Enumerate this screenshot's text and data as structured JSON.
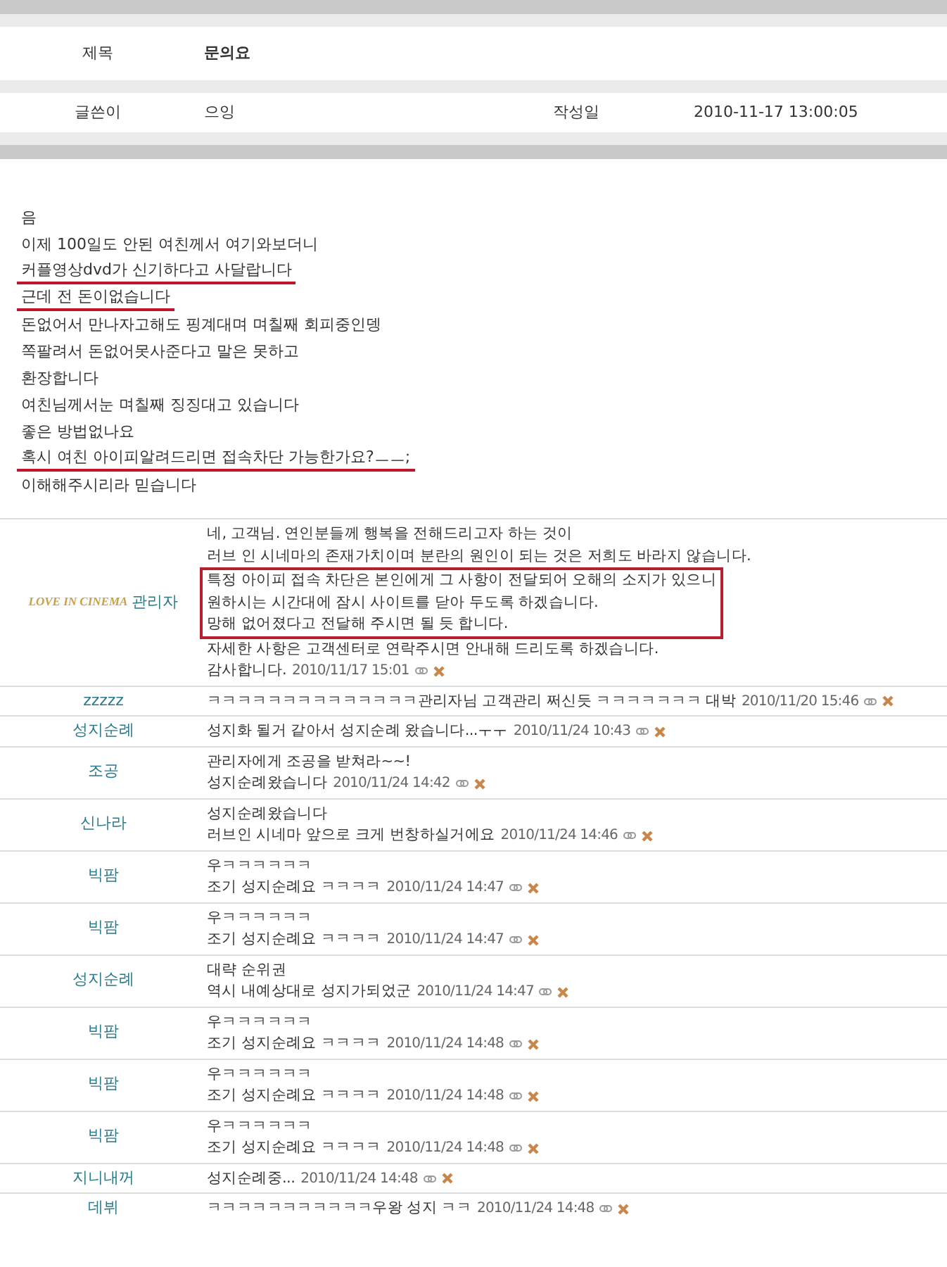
{
  "post": {
    "title_label": "제목",
    "title": "문의요",
    "author_label": "글쓴이",
    "author": "으잉",
    "date_label": "작성일",
    "date": "2010-11-17 13:00:05"
  },
  "body": [
    {
      "text": "음",
      "underlined": false
    },
    {
      "text": "이제 100일도 안된 여친께서 여기와보더니",
      "underlined": false
    },
    {
      "text": "커플영상dvd가 신기하다고 사달랍니다",
      "underlined": true
    },
    {
      "text": "근데 전 돈이없습니다",
      "underlined": true
    },
    {
      "text": "돈없어서 만나자고해도 핑계대며 며칠째 회피중인뎅",
      "underlined": false
    },
    {
      "text": "쪽팔려서 돈없어못사준다고 말은 못하고",
      "underlined": false
    },
    {
      "text": "환장합니다",
      "underlined": false
    },
    {
      "text": "여친님께서눈 며칠째 징징대고 있습니다",
      "underlined": false
    },
    {
      "text": "좋은 방법없나요",
      "underlined": false
    },
    {
      "text": "혹시 여친 아이피알려드리면 접속차단 가능한가요?ㅡㅡ;",
      "underlined": true
    },
    {
      "text": "이해해주시리라 믿습니다",
      "underlined": false
    }
  ],
  "comments": [
    {
      "author": "관리자",
      "logo": "LOVE IN CINEMA",
      "blocks": [
        {
          "boxed": false,
          "lines": [
            "네, 고객님. 연인분들께 행복을 전해드리고자 하는 것이",
            "러브 인 시네마의 존재가치이며 분란의 원인이 되는 것은 저희도 바라지 않습니다."
          ]
        },
        {
          "boxed": true,
          "lines": [
            "특정 아이피 접속 차단은 본인에게 그 사항이 전달되어 오해의 소지가 있으니",
            "원하시는 시간대에 잠시 사이트를 닫아 두도록 하겠습니다.",
            "망해 없어졌다고 전달해 주시면 될 듯 합니다."
          ]
        },
        {
          "boxed": false,
          "lines": [
            "자세한 사항은 고객센터로 연락주시면 안내해 드리도록 하겠습니다.",
            "감사합니다."
          ]
        }
      ],
      "date": "2010/11/17 15:01"
    },
    {
      "author": "zzzzz",
      "blocks": [
        {
          "boxed": false,
          "lines": [
            "ㅋㅋㅋㅋㅋㅋㅋㅋㅋㅋㅋㅋㅋㅋ관리자님 고객관리 쩌신듯 ㅋㅋㅋㅋㅋㅋㅋ 대박"
          ]
        }
      ],
      "date": "2010/11/20 15:46"
    },
    {
      "author": "성지순례",
      "blocks": [
        {
          "boxed": false,
          "lines": [
            "성지화 될거 같아서 성지순례 왔습니다...ㅜㅜ"
          ]
        }
      ],
      "date": "2010/11/24 10:43"
    },
    {
      "author": "조공",
      "blocks": [
        {
          "boxed": false,
          "lines": [
            "관리자에게 조공을 받쳐라~~!",
            "성지순례왔습니다"
          ]
        }
      ],
      "date": "2010/11/24 14:42"
    },
    {
      "author": "신나라",
      "blocks": [
        {
          "boxed": false,
          "lines": [
            "성지순례왔습니다",
            "러브인 시네마 앞으로 크게 번창하실거에요"
          ]
        }
      ],
      "date": "2010/11/24 14:46"
    },
    {
      "author": "빅팜",
      "blocks": [
        {
          "boxed": false,
          "lines": [
            "우ㅋㅋㅋㅋㅋㅋ",
            "조기 성지순례요 ㅋㅋㅋㅋ"
          ]
        }
      ],
      "date": "2010/11/24 14:47"
    },
    {
      "author": "빅팜",
      "blocks": [
        {
          "boxed": false,
          "lines": [
            "우ㅋㅋㅋㅋㅋㅋ",
            "조기 성지순례요 ㅋㅋㅋㅋ"
          ]
        }
      ],
      "date": "2010/11/24 14:47"
    },
    {
      "author": "성지순례",
      "blocks": [
        {
          "boxed": false,
          "lines": [
            "대략 순위권",
            "역시 내예상대로 성지가되었군"
          ]
        }
      ],
      "date": "2010/11/24 14:47"
    },
    {
      "author": "빅팜",
      "blocks": [
        {
          "boxed": false,
          "lines": [
            "우ㅋㅋㅋㅋㅋㅋ",
            "조기 성지순례요 ㅋㅋㅋㅋ"
          ]
        }
      ],
      "date": "2010/11/24 14:48"
    },
    {
      "author": "빅팜",
      "blocks": [
        {
          "boxed": false,
          "lines": [
            "우ㅋㅋㅋㅋㅋㅋ",
            "조기 성지순례요 ㅋㅋㅋㅋ"
          ]
        }
      ],
      "date": "2010/11/24 14:48"
    },
    {
      "author": "빅팜",
      "blocks": [
        {
          "boxed": false,
          "lines": [
            "우ㅋㅋㅋㅋㅋㅋ",
            "조기 성지순례요 ㅋㅋㅋㅋ"
          ]
        }
      ],
      "date": "2010/11/24 14:48"
    },
    {
      "author": "지니내꺼",
      "blocks": [
        {
          "boxed": false,
          "lines": [
            "성지순례중..."
          ]
        }
      ],
      "date": "2010/11/24 14:48"
    },
    {
      "author": "데뷔",
      "blocks": [
        {
          "boxed": false,
          "lines": [
            "ㅋㅋㅋㅋㅋㅋㅋㅋㅋㅋㅋ우왕 성지 ㅋㅋ"
          ]
        }
      ],
      "date": "2010/11/24 14:48"
    }
  ]
}
